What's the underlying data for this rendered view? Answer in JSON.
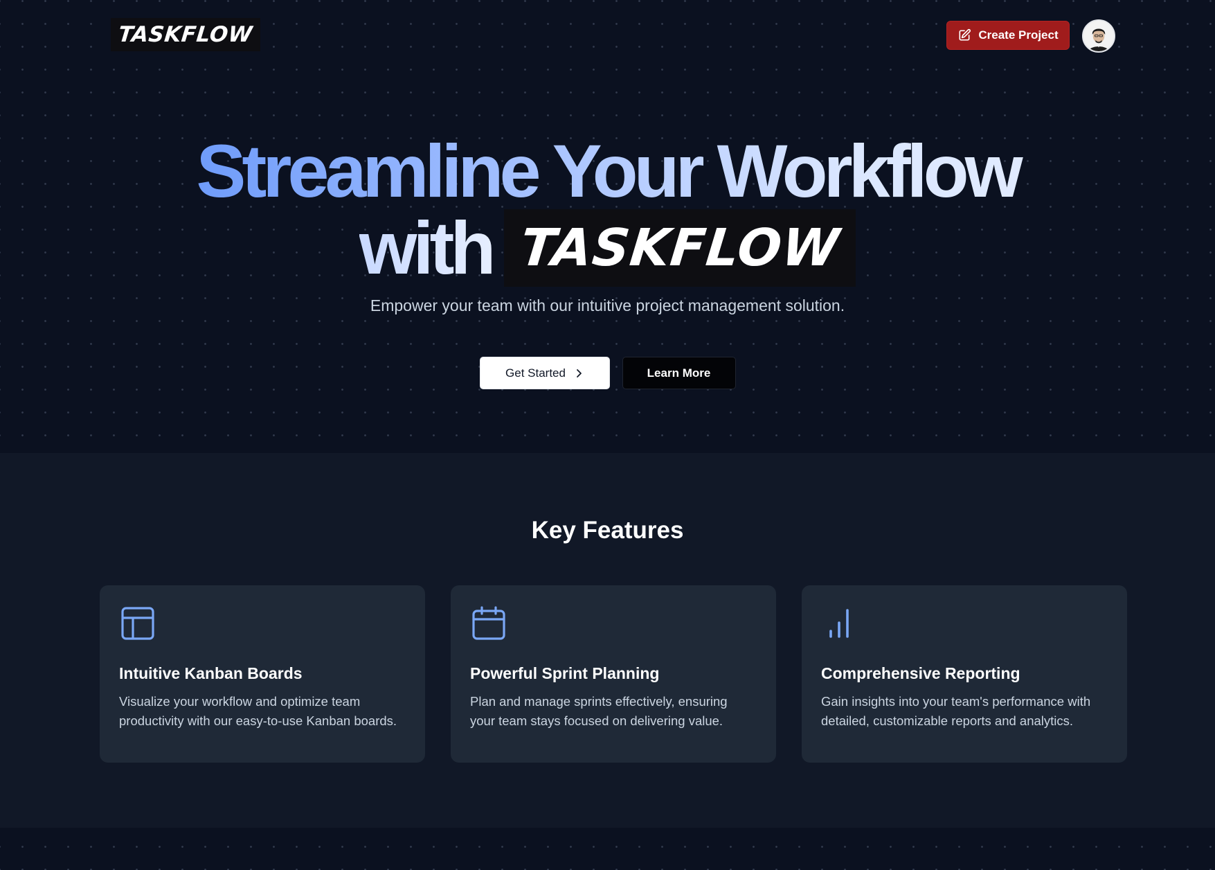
{
  "header": {
    "logo_text": "TASKFLOW",
    "create_button_label": "Create Project"
  },
  "hero": {
    "headline_line1": "Streamline Your Workflow",
    "headline_with": "with",
    "headline_brand": "TASKFLOW",
    "subtitle": "Empower your team with our intuitive project management solution.",
    "primary_button_label": "Get Started",
    "secondary_button_label": "Learn More"
  },
  "features": {
    "title": "Key Features",
    "cards": [
      {
        "icon": "layout-icon",
        "title": "Intuitive Kanban Boards",
        "description": "Visualize your workflow and optimize team productivity with our easy-to-use Kanban boards."
      },
      {
        "icon": "calendar-icon",
        "title": "Powerful Sprint Planning",
        "description": "Plan and manage sprints effectively, ensuring your team stays focused on delivering value."
      },
      {
        "icon": "bar-chart-icon",
        "title": "Comprehensive Reporting",
        "description": "Gain insights into your team's performance with detailed, customizable reports and analytics."
      }
    ]
  },
  "colors": {
    "background": "#0b1120",
    "section_background": "#111827",
    "card_background": "#1f2937",
    "accent_red": "#a01c1c",
    "icon_blue": "#7aa7f5",
    "gradient_start": "#4f86f7",
    "gradient_end": "#e6eeff"
  }
}
